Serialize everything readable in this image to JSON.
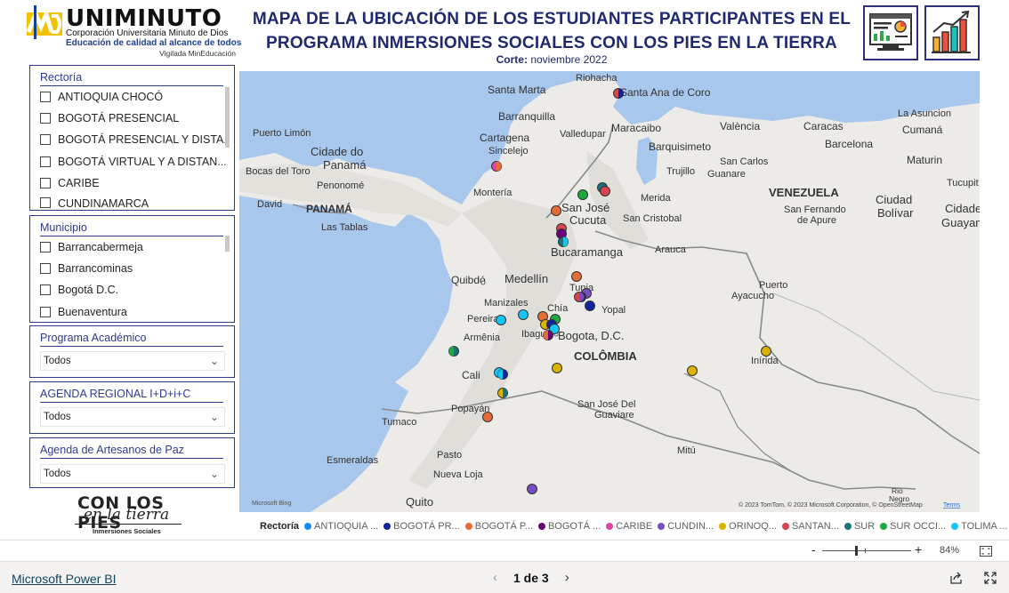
{
  "logo": {
    "brand": "UNIMINUTO",
    "line1": "Corporación Universitaria Minuto de Dios",
    "line2": "Educación de calidad al alcance de todos",
    "line3": "Vigilada MinEducación"
  },
  "header": {
    "title_line1": "MAPA DE LA UBICACIÓN DE LOS ESTUDIANTES PARTICIPANTES EN EL",
    "title_line2": "PROGRAMA INMERSIONES SOCIALES CON LOS PIES EN LA TIERRA",
    "cut_label": "Corte:",
    "cut_value": "noviembre 2022"
  },
  "slicers": {
    "rectoria": {
      "title": "Rectoría",
      "items": [
        "ANTIOQUIA CHOCÓ",
        "BOGOTÁ PRESENCIAL",
        "BOGOTÁ PRESENCIAL Y DISTA...",
        "BOGOTÁ VIRTUAL Y A DISTAN...",
        "CARIBE",
        "CUNDINAMARCA"
      ]
    },
    "municipio": {
      "title": "Municipio",
      "items": [
        "Barrancabermeja",
        "Barrancominas",
        "Bogotá D.C.",
        "Buenaventura"
      ]
    },
    "programa": {
      "title": "Programa Académico",
      "value": "Todos"
    },
    "agenda_regional": {
      "title": "AGENDA REGIONAL I+D+i+C",
      "value": "Todos"
    },
    "agenda_artesanos": {
      "title": "Agenda de Artesanos de Paz",
      "value": "Todos"
    }
  },
  "footer_logo": {
    "line1": "CON LOS PIES",
    "line2": "en la tierra",
    "line3": "Inmersiones Sociales"
  },
  "map": {
    "labels": {
      "riohacha": "Riohacha",
      "santa_marta": "Santa Marta",
      "santa_ana": "Santa Ana de Coro",
      "barranquilla": "Barranquilla",
      "maracaibo": "Maracaibo",
      "valencia": "València",
      "caracas": "Caracas",
      "la_asuncion": "La Asuncion",
      "puerto_limon": "Puerto Limón",
      "cartagena": "Cartagena",
      "valledupar": "Valledupar",
      "barquisimeto": "Barquisimeto",
      "barcelona": "Barcelona",
      "cumana": "Cumaná",
      "cidade_panama": "Cidade do\nPanamá",
      "bocas": "Bocas del Toro",
      "sincelejo": "Sincelejo",
      "trujillo": "Trujillo",
      "san_carlos": "San Carlos",
      "guanare": "Guanare",
      "maturin": "Maturin",
      "penonome": "Penonomé",
      "monteria": "Montería",
      "merida": "Merida",
      "venezuela": "VENEZUELA",
      "tucupita": "Tucupit",
      "david": "David",
      "panama": "PANAMÁ",
      "san_jose_cucuta": "San José\nCucuta",
      "san_cristobal": "San Cristobal",
      "san_fernando": "San Fernando\nde Apure",
      "ciudad_bolivar": "Ciudad\nBolívar",
      "ciudad_guayana": "Cidade\nGuayana",
      "las_tablas": "Las Tablas",
      "bucaramanga": "Bucaramanga",
      "arauca": "Arauca",
      "quibdo": "Quibdó",
      "medellin": "Medellín",
      "puerto_ayacucho": "Puerto\nAyacucho",
      "manizales": "Manizales",
      "tunja": "Tunja",
      "yopal": "Yopal",
      "chia": "Chía",
      "pereira": "Pereira",
      "armenia": "Armênia",
      "ibague": "Ibagué",
      "bogota": "Bogota, D.C.",
      "colombia": "COLÔMBIA",
      "inirida": "Inírida",
      "cali": "Cali",
      "popayan": "Popayán",
      "san_jose_guaviare": "San José Del\nGuaviare",
      "tumaco": "Tumaco",
      "esmeraldas": "Esmeraldas",
      "pasto": "Pasto",
      "nueva_loja": "Nueva Loja",
      "mitu": "Mitú",
      "quito": "Quito",
      "rio_negro": "Rio\nNegro"
    },
    "attribution": "© 2023 TomTom, © 2023 Microsoft Corporation, © OpenStreetMap",
    "terms": "Terms",
    "bing": "Microsoft Bing"
  },
  "legend": {
    "title": "Rectoría",
    "items": [
      {
        "label": "ANTIOQUIA ...",
        "color": "#118DFF"
      },
      {
        "label": "BOGOTÁ PR...",
        "color": "#12239E"
      },
      {
        "label": "BOGOTÁ P...",
        "color": "#E66C37"
      },
      {
        "label": "BOGOTÁ ...",
        "color": "#6B007B"
      },
      {
        "label": "CARIBE",
        "color": "#E044A7"
      },
      {
        "label": "CUNDIN...",
        "color": "#744EC2"
      },
      {
        "label": "ORINOQ...",
        "color": "#D9B300"
      },
      {
        "label": "SANTAN...",
        "color": "#D64550"
      },
      {
        "label": "SUR",
        "color": "#197278"
      },
      {
        "label": "SUR OCCI...",
        "color": "#1AAB40"
      },
      {
        "label": "TOLIMA ...",
        "color": "#15C6F4"
      }
    ]
  },
  "zoom": {
    "minus": "-",
    "plus": "+",
    "level": "84%"
  },
  "footer": {
    "brand": "Microsoft Power BI",
    "page": "1 de 3"
  }
}
